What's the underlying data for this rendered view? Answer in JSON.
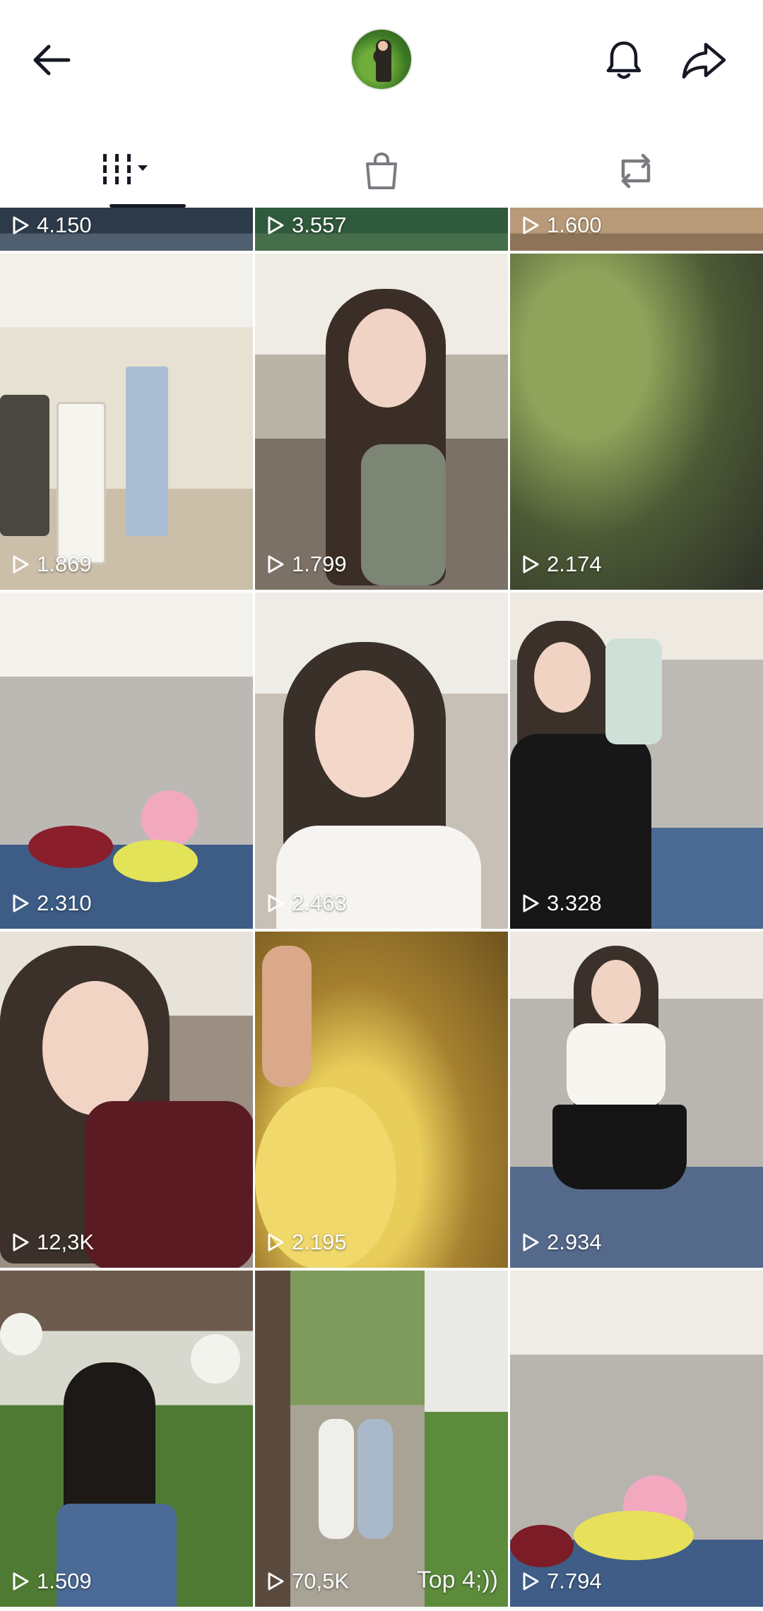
{
  "header": {
    "back_icon": "arrow-left-icon",
    "avatar_icon": "profile-avatar",
    "bell_icon": "bell-icon",
    "share_icon": "share-arrow-icon"
  },
  "tabs": [
    {
      "name": "videos-grid",
      "icon": "grid-columns-icon",
      "selected": true
    },
    {
      "name": "shop",
      "icon": "shopping-bag-icon",
      "selected": false
    },
    {
      "name": "reposts",
      "icon": "repost-icon",
      "selected": false
    }
  ],
  "grid": {
    "row0": [
      {
        "views": "4.150"
      },
      {
        "views": "3.557"
      },
      {
        "views": "1.600"
      }
    ],
    "row1": [
      {
        "views": "1.869"
      },
      {
        "views": "1.799"
      },
      {
        "views": "2.174"
      }
    ],
    "row2": [
      {
        "views": "2.310"
      },
      {
        "views": "2.463"
      },
      {
        "views": "3.328"
      }
    ],
    "row3": [
      {
        "views": "12,3K"
      },
      {
        "views": "2.195"
      },
      {
        "views": "2.934"
      }
    ],
    "row4": [
      {
        "views": "1.509"
      },
      {
        "views": "70,5K",
        "overlay": "Top 4;))"
      },
      {
        "views": "7.794"
      }
    ]
  },
  "colors": {
    "text_primary": "#161823",
    "count_text": "#ffffff",
    "background": "#ffffff"
  }
}
